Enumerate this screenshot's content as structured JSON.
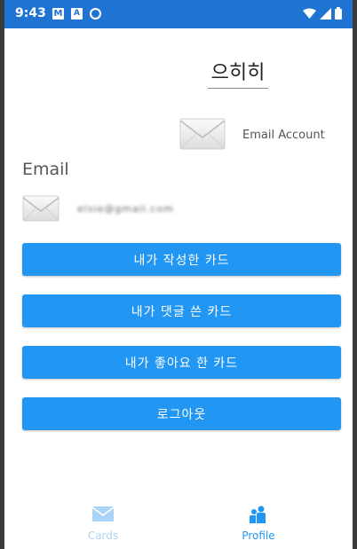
{
  "status_bar": {
    "time": "9:43",
    "notification_icons": [
      "gmail-icon",
      "a-badge-icon",
      "sync-icon"
    ],
    "system_icons": [
      "wifi-icon",
      "signal-icon",
      "battery-icon"
    ]
  },
  "profile": {
    "nickname": "으히히",
    "email_account_label": "Email Account",
    "email_heading": "Email",
    "email_value": "elsie@gmail.com"
  },
  "buttons": {
    "my_cards": "내가 작성한 카드",
    "my_comments": "내가 댓글 쓴 카드",
    "my_likes": "내가 좋아요 한 카드",
    "logout": "로그아웃"
  },
  "tabs": [
    {
      "label": "Cards",
      "icon": "envelope-icon"
    },
    {
      "label": "Profile",
      "icon": "people-icon"
    }
  ],
  "colors": {
    "status_bar": "#1f74d3",
    "primary": "#2196f3",
    "tab_inactive": "#a9d4f7"
  }
}
